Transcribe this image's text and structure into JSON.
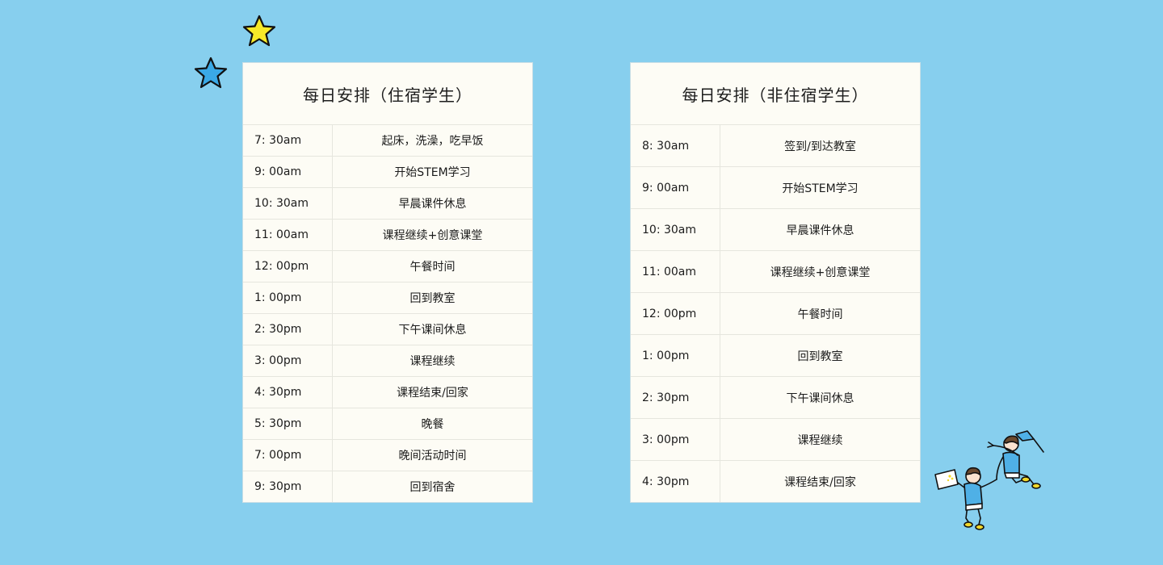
{
  "colors": {
    "background": "#87cfee",
    "card": "#fdfcf5",
    "star_yellow": "#f7e928",
    "star_blue": "#3aa9e6"
  },
  "decorations": {
    "stars": [
      "yellow-star-icon",
      "blue-star-icon"
    ],
    "illustration": "kids-holding-hands-illustration"
  },
  "boarding": {
    "title": "每日安排（住宿学生）",
    "rows": [
      {
        "time": "7: 30am",
        "activity": "起床，洗澡，吃早饭"
      },
      {
        "time": "9: 00am",
        "activity": "开始STEM学习"
      },
      {
        "time": "10: 30am",
        "activity": "早晨课件休息"
      },
      {
        "time": "11: 00am",
        "activity": "课程继续+创意课堂"
      },
      {
        "time": "12: 00pm",
        "activity": "午餐时间"
      },
      {
        "time": "1: 00pm",
        "activity": "回到教室"
      },
      {
        "time": "2: 30pm",
        "activity": "下午课间休息"
      },
      {
        "time": "3: 00pm",
        "activity": "课程继续"
      },
      {
        "time": "4: 30pm",
        "activity": "课程结束/回家"
      },
      {
        "time": "5: 30pm",
        "activity": "晚餐"
      },
      {
        "time": "7: 00pm",
        "activity": "晚间活动时间"
      },
      {
        "time": "9: 30pm",
        "activity": "回到宿舍"
      }
    ]
  },
  "day": {
    "title": "每日安排（非住宿学生）",
    "rows": [
      {
        "time": "8: 30am",
        "activity": "签到/到达教室"
      },
      {
        "time": "9: 00am",
        "activity": "开始STEM学习"
      },
      {
        "time": "10: 30am",
        "activity": "早晨课件休息"
      },
      {
        "time": "11: 00am",
        "activity": "课程继续+创意课堂"
      },
      {
        "time": "12: 00pm",
        "activity": "午餐时间"
      },
      {
        "time": "1: 00pm",
        "activity": "回到教室"
      },
      {
        "time": "2: 30pm",
        "activity": "下午课间休息"
      },
      {
        "time": "3: 00pm",
        "activity": "课程继续"
      },
      {
        "time": "4: 30pm",
        "activity": "课程结束/回家"
      }
    ]
  }
}
